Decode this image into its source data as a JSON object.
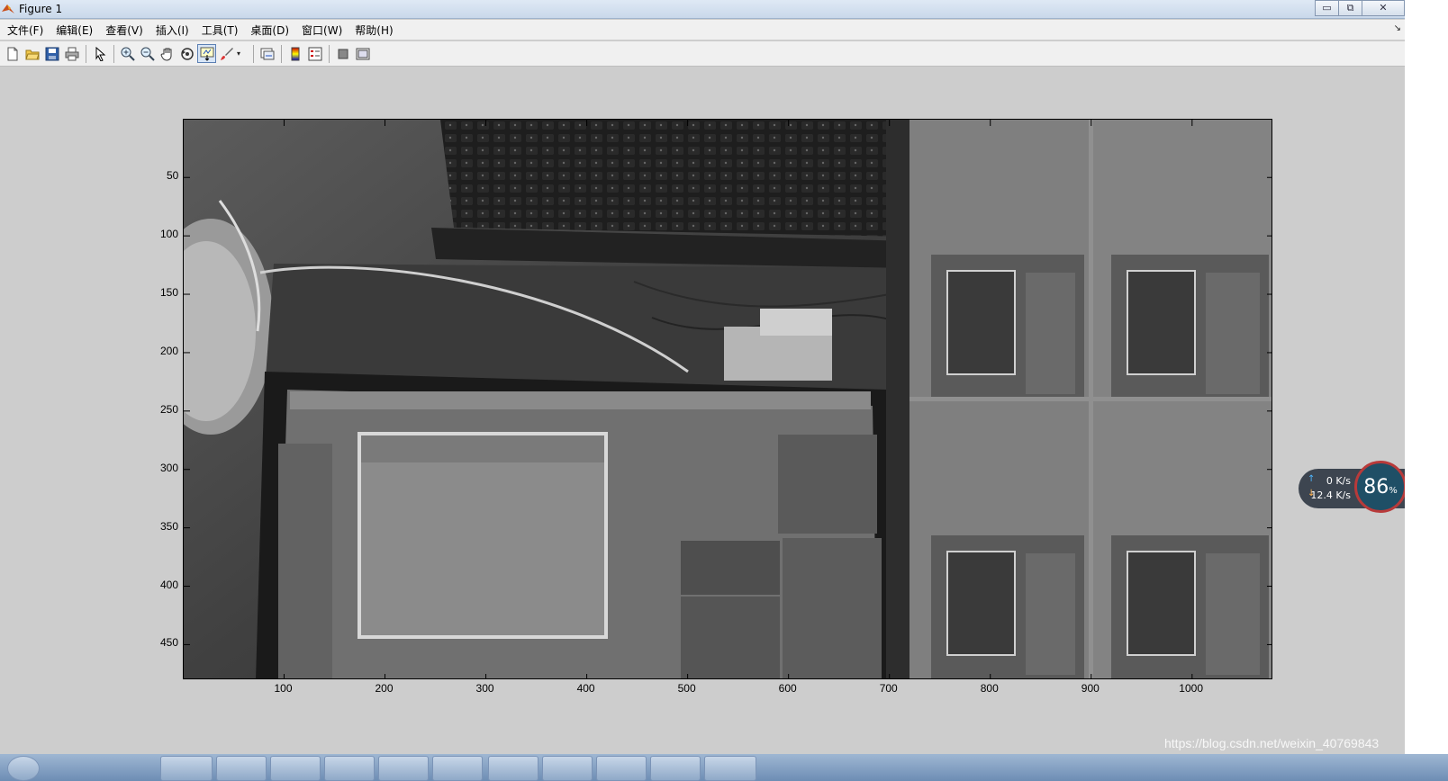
{
  "window": {
    "title": "Figure 1",
    "controls": [
      "▭",
      "⧉",
      "✕"
    ]
  },
  "menubar": {
    "items": [
      "文件(F)",
      "编辑(E)",
      "查看(V)",
      "插入(I)",
      "工具(T)",
      "桌面(D)",
      "窗口(W)",
      "帮助(H)"
    ]
  },
  "toolbar": {
    "buttons": [
      {
        "icon": "new-figure-icon"
      },
      {
        "icon": "open-file-icon"
      },
      {
        "icon": "save-icon"
      },
      {
        "icon": "print-icon"
      },
      {
        "icon": "edit-plot-arrow-icon"
      },
      {
        "icon": "zoom-in-icon"
      },
      {
        "icon": "zoom-out-icon"
      },
      {
        "icon": "pan-hand-icon"
      },
      {
        "icon": "rotate-3d-icon"
      },
      {
        "icon": "data-cursor-icon",
        "active": true
      },
      {
        "icon": "brush-icon"
      },
      {
        "icon": "link-plot-icon"
      },
      {
        "icon": "insert-colorbar-icon"
      },
      {
        "icon": "insert-legend-icon"
      },
      {
        "icon": "hide-plot-tools-icon"
      },
      {
        "icon": "show-plot-tools-icon"
      }
    ]
  },
  "axes": {
    "x_ticks": [
      {
        "label": "100",
        "value": 100
      },
      {
        "label": "200",
        "value": 200
      },
      {
        "label": "300",
        "value": 300
      },
      {
        "label": "400",
        "value": 400
      },
      {
        "label": "500",
        "value": 500
      },
      {
        "label": "600",
        "value": 600
      },
      {
        "label": "700",
        "value": 700
      },
      {
        "label": "800",
        "value": 800
      },
      {
        "label": "900",
        "value": 900
      },
      {
        "label": "1000",
        "value": 1000
      }
    ],
    "y_ticks": [
      {
        "label": "50",
        "value": 50
      },
      {
        "label": "100",
        "value": 100
      },
      {
        "label": "150",
        "value": 150
      },
      {
        "label": "200",
        "value": 200
      },
      {
        "label": "250",
        "value": 250
      },
      {
        "label": "300",
        "value": 300
      },
      {
        "label": "350",
        "value": 350
      },
      {
        "label": "400",
        "value": 400
      },
      {
        "label": "450",
        "value": 450
      }
    ],
    "xlim": [
      0.5,
      1080.5
    ],
    "ylim": [
      0.5,
      480.5
    ],
    "y_reversed": true
  },
  "net_widget": {
    "upload": "0 K/s",
    "download": "12.4 K/s",
    "percent": "86",
    "percent_unit": "%"
  },
  "watermark": "https://blog.csdn.net/weixin_40769843"
}
